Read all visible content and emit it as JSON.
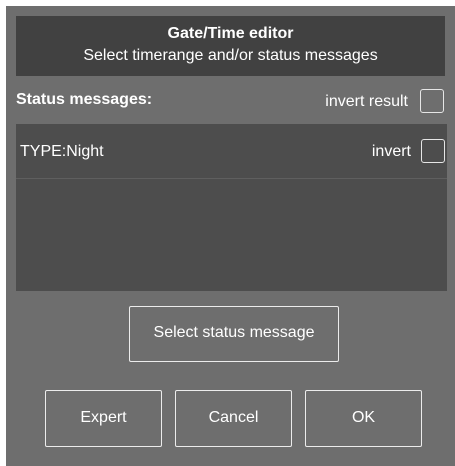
{
  "header": {
    "title": "Gate/Time editor",
    "subtitle": "Select timerange and/or status messages"
  },
  "status": {
    "label": "Status messages:",
    "invert_result_label": "invert result",
    "invert_result_checked": false
  },
  "list": {
    "items": [
      {
        "label": "TYPE:Night",
        "invert_label": "invert",
        "invert_checked": false
      }
    ]
  },
  "buttons": {
    "select_status": "Select status message",
    "expert": "Expert",
    "cancel": "Cancel",
    "ok": "OK"
  },
  "colors": {
    "dialog_bg": "#6e6e6e",
    "header_bg": "#414141",
    "list_bg": "#4d4d4d",
    "text": "#ffffff"
  }
}
